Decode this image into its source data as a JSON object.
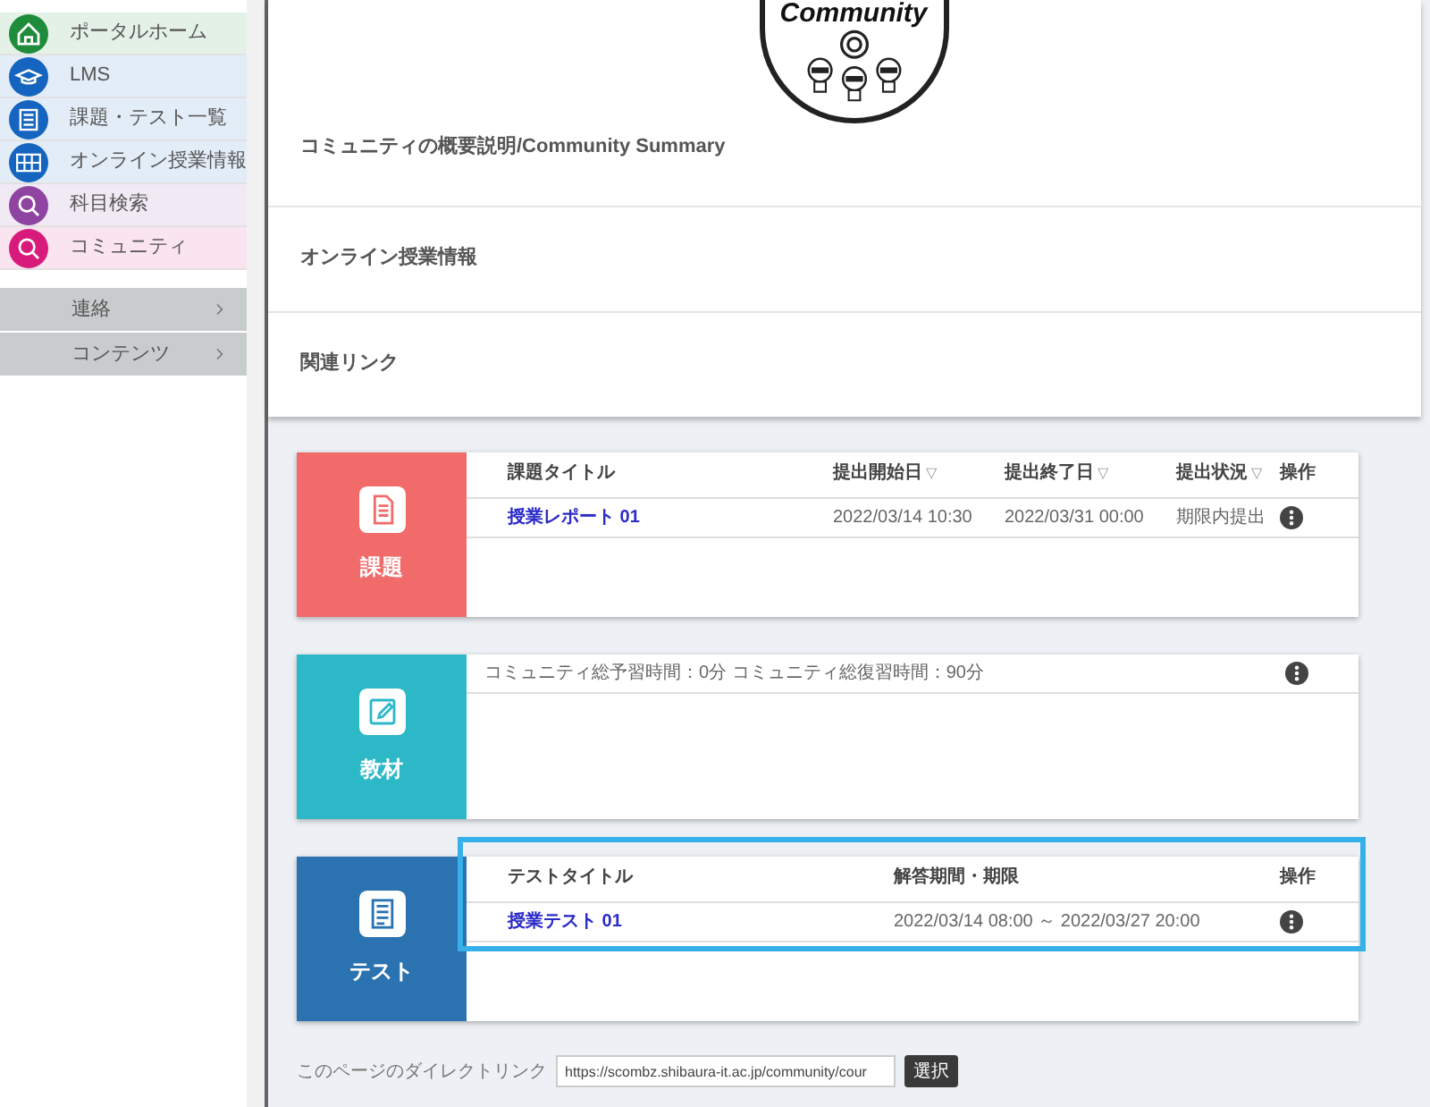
{
  "sidebar": {
    "items": [
      {
        "label": "ポータルホーム",
        "kind": "home",
        "color": "#1e8c3a"
      },
      {
        "label": "LMS",
        "kind": "cap",
        "color": "#1565c0"
      },
      {
        "label": "課題・テスト一覧",
        "kind": "list",
        "color": "#1565c0"
      },
      {
        "label": "オンライン授業情報",
        "kind": "grid",
        "color": "#1565c0"
      },
      {
        "label": "科目検索",
        "kind": "search",
        "color": "#8e44a0"
      },
      {
        "label": "コミュニティ",
        "kind": "search",
        "color": "#d81b7a"
      }
    ],
    "groups": [
      {
        "label": "連絡",
        "expanded": false
      },
      {
        "label": "コンテンツ",
        "expanded": false
      }
    ]
  },
  "logo": {
    "text": "Community"
  },
  "sections": [
    {
      "title": "コミュニティの概要説明/Community Summary"
    },
    {
      "title": "オンライン授業情報"
    },
    {
      "title": "関連リンク"
    }
  ],
  "cards": [
    {
      "kind": "table",
      "label": "課題",
      "color": "#f26b6b",
      "highlighted": false,
      "columns": [
        {
          "label": "課題タイトル"
        },
        {
          "label": "提出開始日",
          "sort": "▽"
        },
        {
          "label": "提出終了日",
          "sort": "▽"
        },
        {
          "label": "提出状況",
          "sort": "▽"
        },
        {
          "label": "操作"
        }
      ],
      "rows": [
        {
          "cells": [
            "授業レポート 01",
            "2022/03/14 10:30",
            "2022/03/31 00:00",
            "期限内提出"
          ]
        }
      ]
    },
    {
      "kind": "note",
      "label": "教材",
      "color": "#2db8c8",
      "highlighted": false,
      "note": "コミュニティ総予習時間：0分 コミュニティ総復習時間：90分"
    },
    {
      "kind": "table",
      "label": "テスト",
      "color": "#2a72b0",
      "highlighted": true,
      "columns": [
        {
          "label": "テストタイトル"
        },
        {
          "label": "解答期間・期限"
        },
        {
          "label": "操作"
        }
      ],
      "rows": [
        {
          "cells": [
            "授業テスト 01",
            "2022/03/14 08:00 ～ 2022/03/27 20:00"
          ]
        }
      ]
    }
  ],
  "footer": {
    "label": "このページのダイレクトリンク",
    "url": "https://scombz.shibaura-it.ac.jp/community/cour",
    "button": "選択"
  }
}
